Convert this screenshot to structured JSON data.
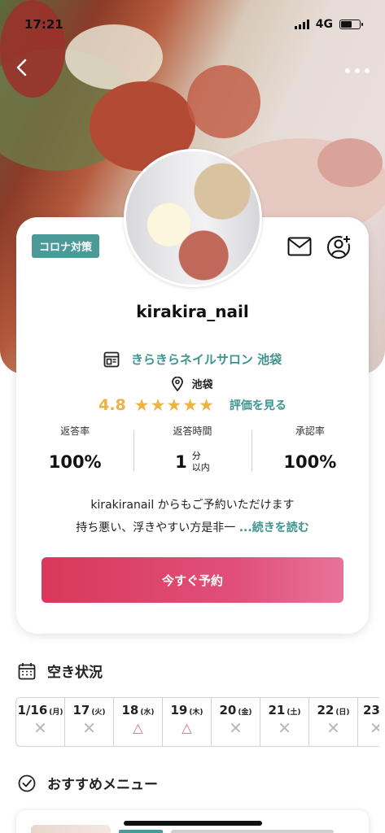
{
  "status_bar": {
    "time": "17:21",
    "network": "4G"
  },
  "colors": {
    "accent_teal": "#4b9a97",
    "book_button": "#d9385b",
    "star": "#eab543",
    "triangle": "#e16b86"
  },
  "nav": {
    "back_icon": "chevron-left-icon",
    "more_icon": "more-dots-icon"
  },
  "profile": {
    "badge": "コロナ対策",
    "username": "kirakira_nail",
    "salon_name": "きらきらネイルサロン 池袋",
    "location": "池袋",
    "rating": "4.8",
    "stars": "★★★★★",
    "review_link": "評価を見る",
    "stats": [
      {
        "label": "返答率",
        "value": "100%"
      },
      {
        "label": "返答時間",
        "value": "1",
        "unit_top": "分",
        "unit_bottom": "以内"
      },
      {
        "label": "承認率",
        "value": "100%"
      }
    ],
    "description_line1": "kirakiranail からもご予約いただけます",
    "description_line2": "持ち悪い、浮きやすい方是非一",
    "read_more": "...続きを読む",
    "book_button": "今すぐ予約"
  },
  "availability": {
    "title": "空き状況",
    "days": [
      {
        "date": "1/16",
        "dow": "(月)",
        "mark": "✕"
      },
      {
        "date": "17",
        "dow": "(火)",
        "mark": "✕"
      },
      {
        "date": "18",
        "dow": "(水)",
        "mark": "△"
      },
      {
        "date": "19",
        "dow": "(木)",
        "mark": "△"
      },
      {
        "date": "20",
        "dow": "(金)",
        "mark": "✕"
      },
      {
        "date": "21",
        "dow": "(土)",
        "mark": "✕"
      },
      {
        "date": "22",
        "dow": "(日)",
        "mark": "✕"
      },
      {
        "date": "23",
        "dow": "",
        "mark": "✕"
      }
    ]
  },
  "recommended": {
    "title": "おすすめメニュー"
  }
}
